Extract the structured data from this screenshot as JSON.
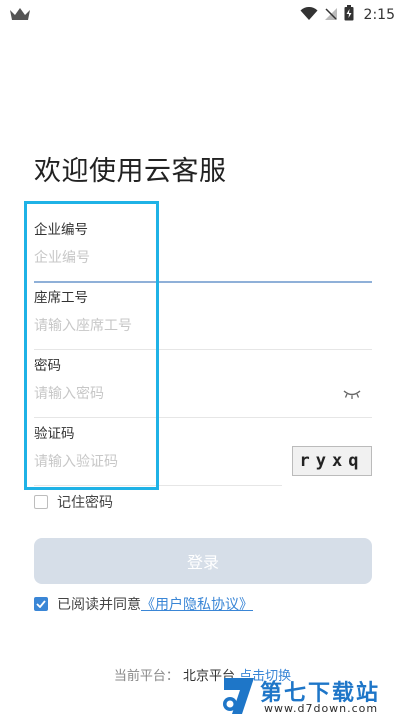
{
  "status_bar": {
    "time": "2:15",
    "icons": [
      "crown-icon",
      "wifi-icon",
      "signal-off-icon",
      "battery-icon"
    ]
  },
  "title": "欢迎使用云客服",
  "form": {
    "company": {
      "label": "企业编号",
      "placeholder": "企业编号",
      "value": ""
    },
    "seat": {
      "label": "座席工号",
      "placeholder": "请输入座席工号",
      "value": ""
    },
    "password": {
      "label": "密码",
      "placeholder": "请输入密码",
      "value": ""
    },
    "captcha": {
      "label": "验证码",
      "placeholder": "请输入验证码",
      "value": "",
      "code": "ryxq"
    }
  },
  "remember_label": "记住密码",
  "login_label": "登录",
  "agreement": {
    "prefix": "已阅读并同意",
    "link": "《用户隐私协议》"
  },
  "platform": {
    "label": "当前平台：",
    "value": "北京平台",
    "switch": "点击切换"
  },
  "watermark": {
    "title": "第七下载站",
    "url": "www.d7down.com"
  },
  "colors": {
    "accent": "#3a86d6",
    "highlight": "#1fb2e6",
    "button_disabled": "#d6dee8"
  }
}
